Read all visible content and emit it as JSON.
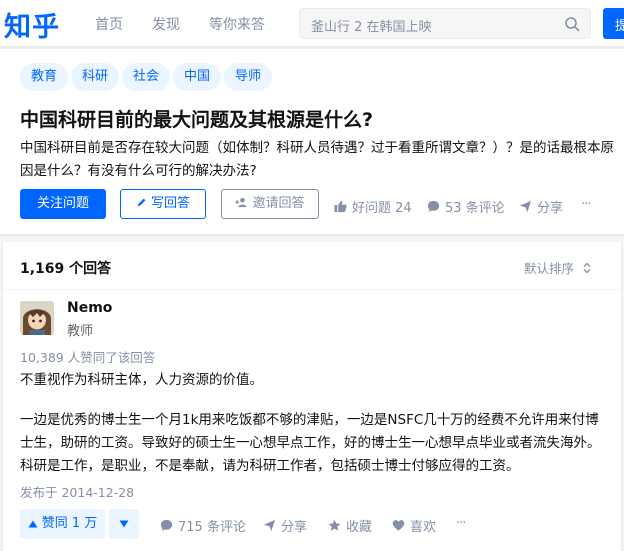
{
  "topbar": {
    "logo": "知乎",
    "nav": [
      "首页",
      "发现",
      "等你来答"
    ],
    "search_placeholder": "釜山行 2 在韩国上映",
    "ask_label": "提问"
  },
  "question": {
    "tags": [
      "教育",
      "科研",
      "社会",
      "中国",
      "导师"
    ],
    "title": "中国科研目前的最大问题及其根源是什么?",
    "description_line1": "中国科研目前是否存在较大问题（如体制？科研人员待遇？过于看重所谓文章？）？是的话最根本原",
    "description_line2": "因是什么？有没有什么可行的解决办法?",
    "follow_label": "关注问题",
    "answer_label": "写回答",
    "invite_label": "邀请回答",
    "good_question_label": "好问题 24",
    "comments_label": "53 条评论",
    "share_label": "分享",
    "more_label": "···"
  },
  "answers": {
    "count_label": "1,169 个回答",
    "sort_label": "默认排序",
    "author": "Nemo",
    "headline": "教师",
    "votes_text": "10,389 人赞同了该回答",
    "para1": "不重视作为科研主体，人力资源的价值。",
    "para2_line1": "一边是优秀的博士生一个月1k用来吃饭都不够的津贴，一边是NSFC几十万的经费不允许用来付博",
    "para2_line2": "士生，助研的工资。导致好的硕士生一心想早点工作，好的博士生一心想早点毕业或者流失海外。",
    "para2_line3": "科研是工作，是职业，不是奉献，请为科研工作者，包括硕士博士付够应得的工资。",
    "date": "发布于 2014-12-28",
    "vote_up_label": "赞同 1 万",
    "comments_label": "715 条评论",
    "share_label": "分享",
    "collect_label": "收藏",
    "like_label": "喜欢",
    "more_label": "···"
  },
  "colors": {
    "brand": "#0066ff",
    "muted": "#8590a6",
    "tag_bg": "#ebf5ff"
  }
}
